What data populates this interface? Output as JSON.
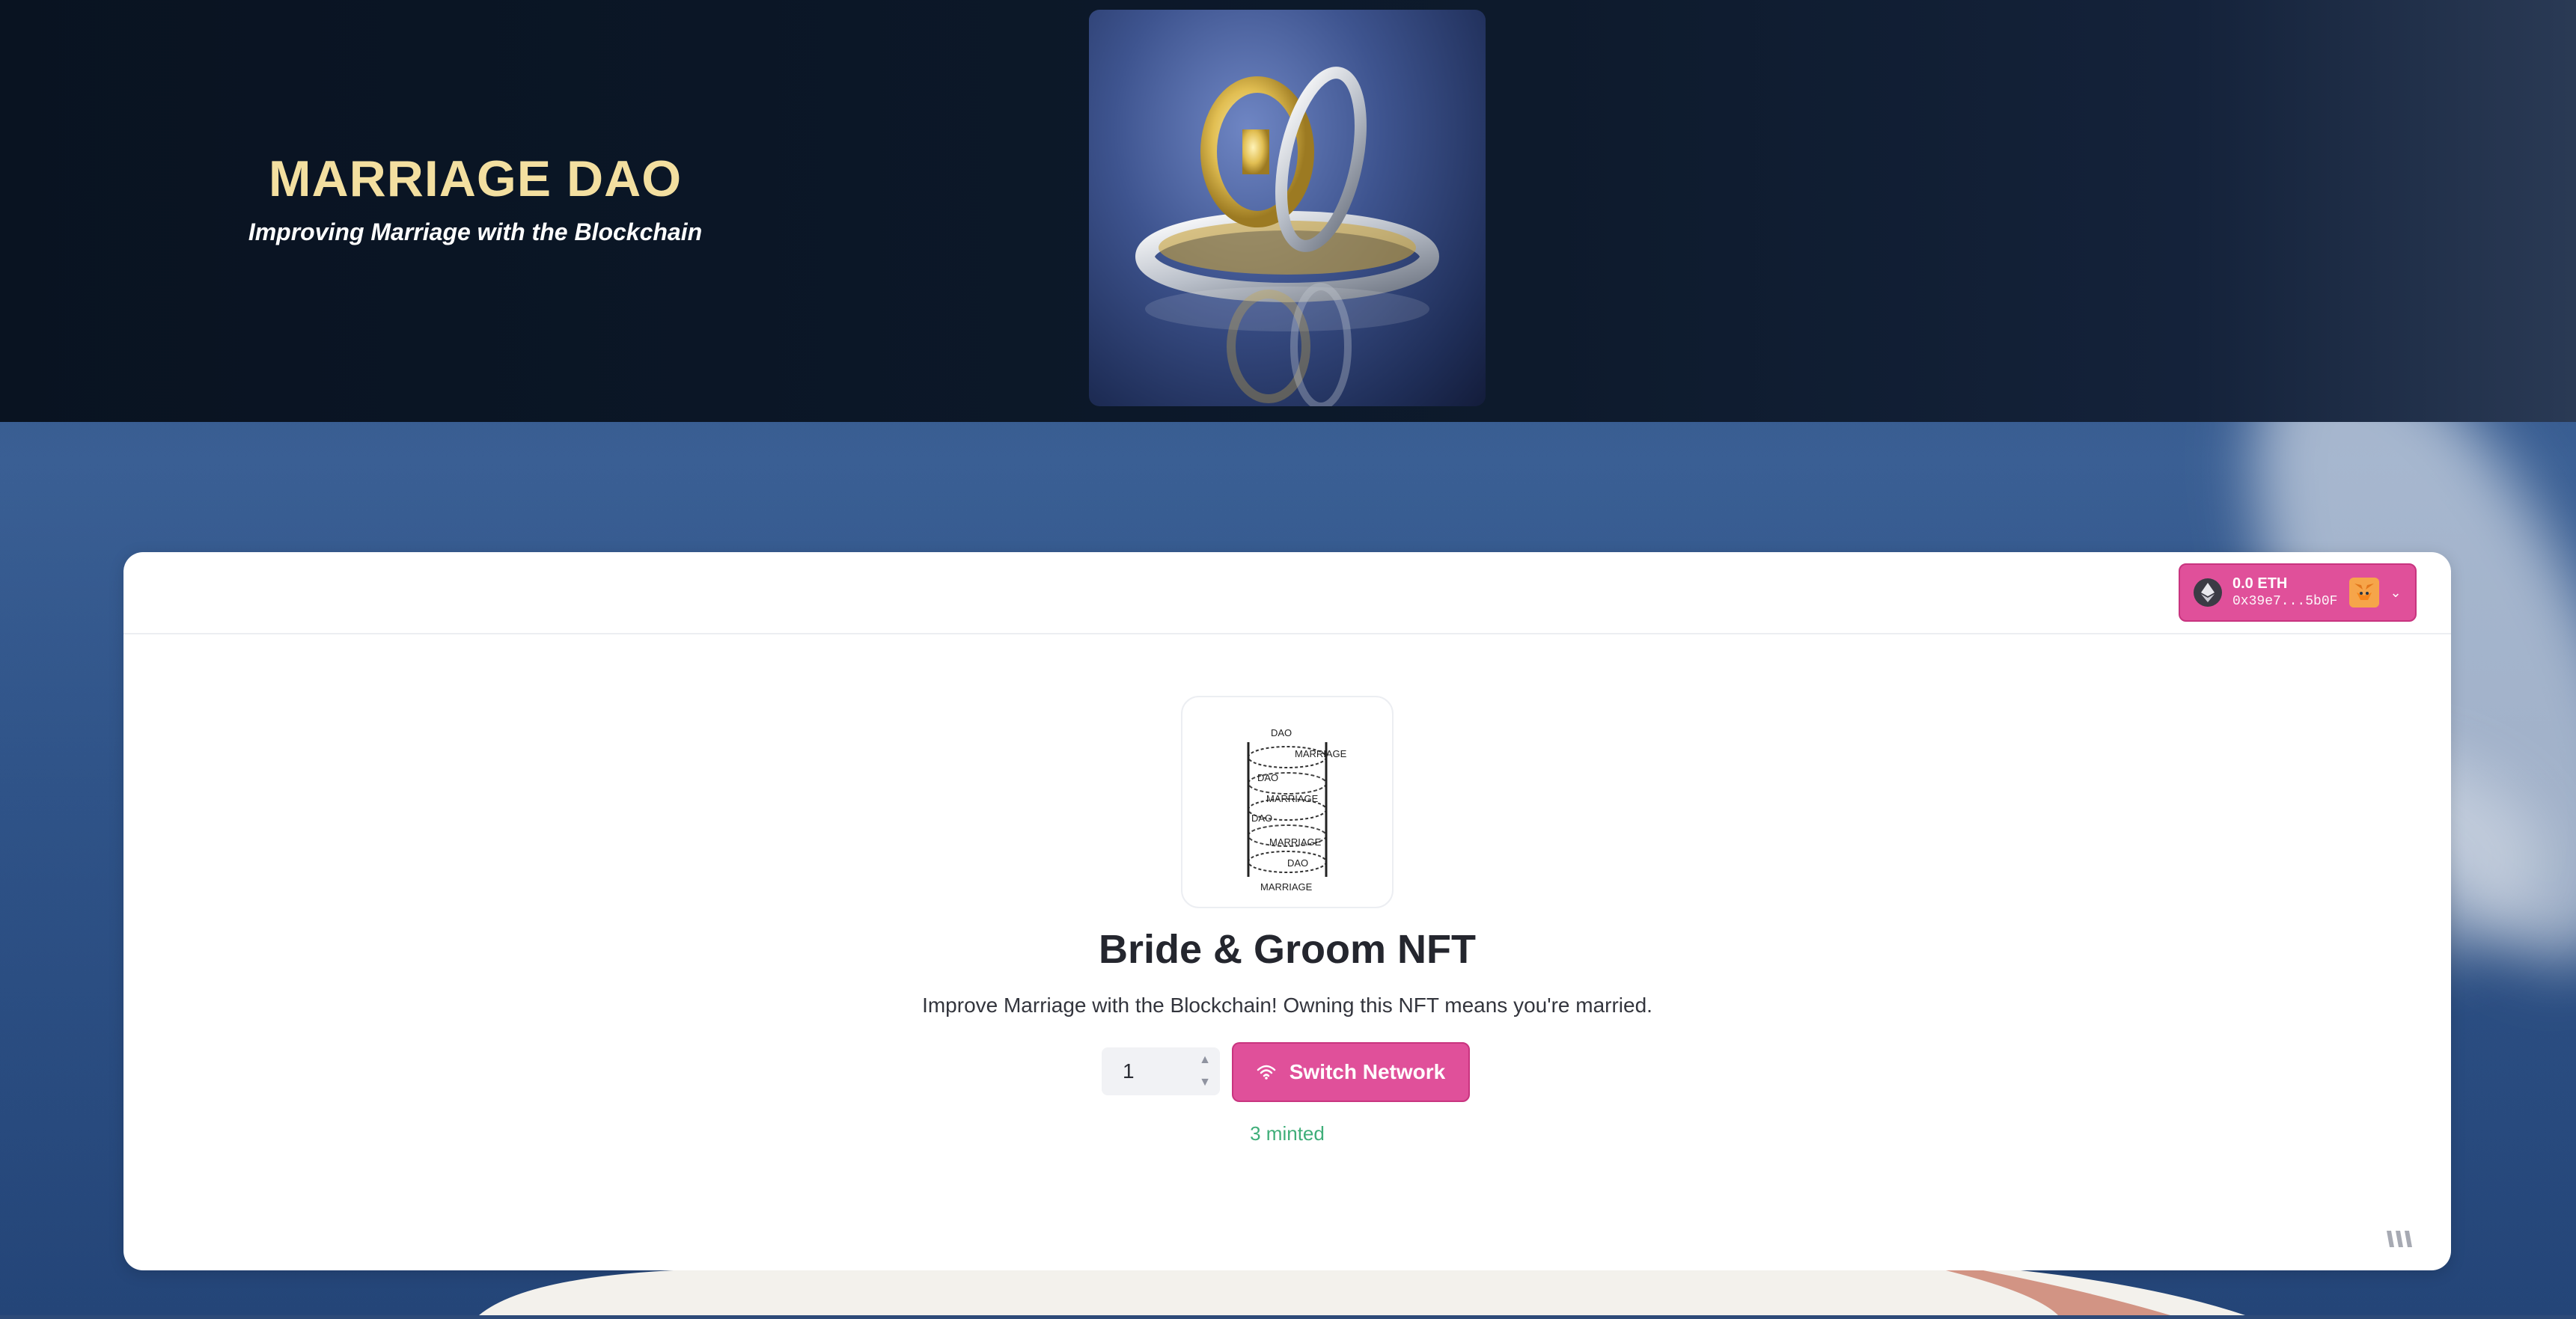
{
  "hero": {
    "title": "MARRIAGE DAO",
    "subtitle": "Improving Marriage with the Blockchain"
  },
  "wallet": {
    "balance": "0.0 ETH",
    "address": "0x39e7...5b0F",
    "eth_icon": "ethereum-icon",
    "wallet_icon": "metamask-fox-icon",
    "dropdown_icon": "chevron-down-icon"
  },
  "nft": {
    "title": "Bride & Groom NFT",
    "description": "Improve Marriage with the Blockchain! Owning this NFT means you're married.",
    "image_text": [
      "DAO",
      "MARRIAGE",
      "DAO",
      "MARRIAGE",
      "DAO",
      "MARRIAGE",
      "DAO",
      "MARRIAGE"
    ]
  },
  "mint": {
    "quantity": "1",
    "button_label": "Switch Network",
    "button_icon": "wifi-icon",
    "minted_status": "3 minted"
  },
  "colors": {
    "accent": "#e0509a",
    "title_gold": "#f3dfa0",
    "minted_green": "#3fae79",
    "hero_bg": "#0d1a2c"
  }
}
